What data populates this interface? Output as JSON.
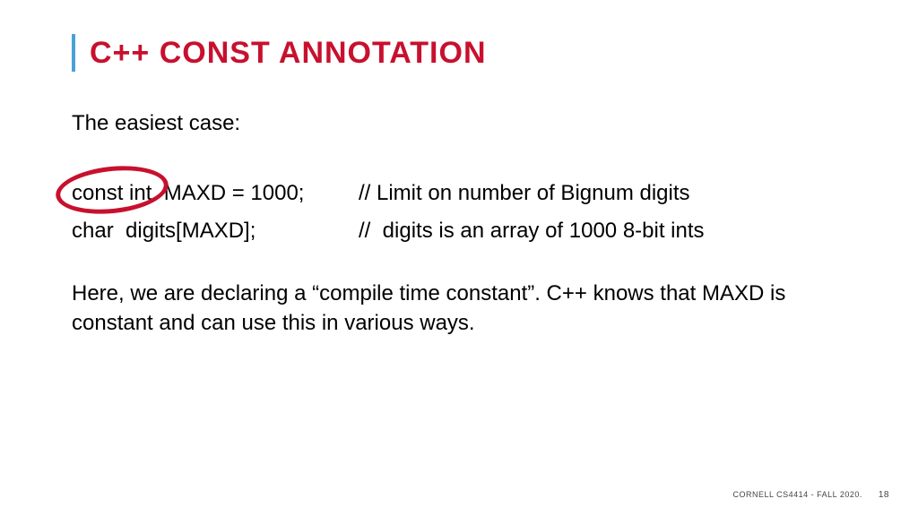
{
  "title": "C++ CONST ANNOTATION",
  "intro": "The easiest case:",
  "code": {
    "line1": {
      "code": "const int  MAXD = 1000;",
      "comment": "// Limit on number of Bignum digits"
    },
    "line2": {
      "code": "char  digits[MAXD];",
      "comment": "//  digits is an array of 1000 8-bit ints"
    }
  },
  "explain": "Here, we are declaring a “compile time constant”. C++ knows that MAXD is constant and can use this in various ways.",
  "footer": {
    "course": "CORNELL CS4414 - FALL 2020.",
    "page": "18"
  }
}
